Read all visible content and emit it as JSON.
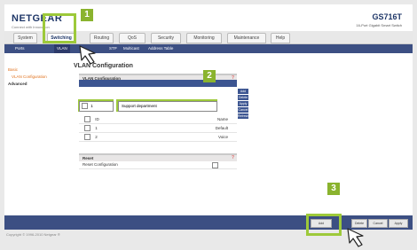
{
  "header": {
    "logo": "NETGEAR",
    "logo_sub": "Connect with Innovation",
    "model": "GS716T",
    "model_sub": "16-Port Gigabit Smart Switch"
  },
  "nav": {
    "tabs": [
      "System",
      "Switching",
      "Routing",
      "QoS",
      "Security",
      "Monitoring",
      "Maintenance",
      "Help"
    ]
  },
  "subnav": {
    "items": [
      "Ports",
      "VLAN",
      "STP",
      "Multicast",
      "Address Table"
    ]
  },
  "sidebar": {
    "items": [
      "Basic",
      "VLAN Configuration",
      "Advanced"
    ]
  },
  "page": {
    "title": "VLAN Configuration"
  },
  "vlan_panel": {
    "title": "VLAN Configuration",
    "id_value": "1",
    "name_value": "Support department",
    "rows": [
      {
        "label": "ID",
        "value": "Name"
      },
      {
        "label": "1",
        "value": "Default"
      },
      {
        "label": "2",
        "value": "Voice"
      }
    ],
    "side_buttons": [
      "Add",
      "Delete",
      "Apply",
      "Cancel",
      "Refresh"
    ]
  },
  "reset_panel": {
    "title": "Reset",
    "label": "Reset Configuration"
  },
  "bottom_buttons": [
    "Add",
    "Delete",
    "Cancel",
    "Apply"
  ],
  "footer": {
    "copyright": "Copyright © 1996-2010 Netgear ®"
  },
  "callouts": [
    "1",
    "2",
    "3"
  ],
  "colors": {
    "brand": "#1f3768",
    "nav_blue": "#3c4f83",
    "highlight": "#9dc93a",
    "badge": "#8ab32e"
  }
}
